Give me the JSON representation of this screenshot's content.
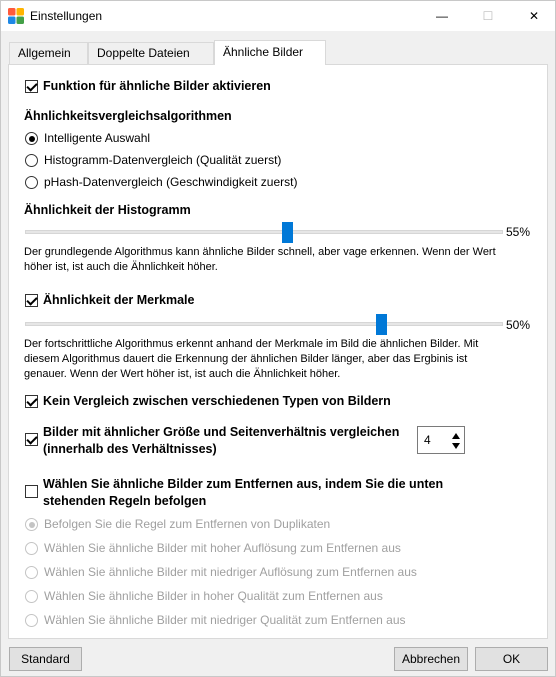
{
  "window": {
    "title": "Einstellungen",
    "min_glyph": "—",
    "max_glyph": "☐",
    "close_glyph": "✕",
    "icon": "app-logo-icon"
  },
  "tabs": [
    {
      "label": "Allgemein"
    },
    {
      "label": "Doppelte Dateien"
    },
    {
      "label": "Ähnliche Bilder",
      "active": true
    }
  ],
  "settings": {
    "enable_label": "Funktion für ähnliche Bilder aktivieren",
    "enable_checked": true,
    "algo_heading": "Ähnlichkeitsvergleichsalgorithmen",
    "algos": [
      {
        "label": "Intelligente Auswahl",
        "selected": true
      },
      {
        "label": "Histogramm-Datenvergleich (Qualität zuerst)",
        "selected": false
      },
      {
        "label": "pHash-Datenvergleich (Geschwindigkeit zuerst)",
        "selected": false
      }
    ],
    "histogram_heading": "Ähnlichkeit der Histogramm",
    "histogram_value": 0.55,
    "histogram_pct": "55%",
    "histogram_desc_1": "Der grundlegende Algorithmus kann ähnliche Bilder schnell, aber vage erkennen. Wenn der Wert",
    "histogram_desc_2": "höher ist, ist auch die Ähnlichkeit höher.",
    "features_label": "Ähnlichkeit der Merkmale",
    "features_checked": true,
    "features_value": 0.5,
    "features_pct": "50%",
    "features_desc_1": "Der fortschrittliche Algorithmus erkennt anhand der Merkmale im Bild die ähnlichen Bilder. Mit",
    "features_desc_2": "diesem Algorithmus  dauert die Erkennung der ähnlichen Bilder länger, aber das Ergbinis ist",
    "features_desc_3": "genauer. Wenn der Wert höher ist, ist auch die Ähnlichkeit höher.",
    "no_compare_label": "Kein Vergleich zwischen verschiedenen Typen von Bildern",
    "no_compare_checked": true,
    "size_label_1": "Bilder mit ähnlicher Größe und Seitenverhältnis vergleichen",
    "size_label_2": "(innerhalb des Verhältnisses)",
    "size_checked": true,
    "size_ratio": "4",
    "select_label_1": "Wählen Sie ähnliche Bilder zum Entfernen aus, indem Sie die unten",
    "select_label_2": "stehenden Regeln befolgen",
    "select_checked": false,
    "rules": [
      {
        "label": "Befolgen Sie die Regel zum Entfernen von Duplikaten",
        "selected": true
      },
      {
        "label": "Wählen Sie ähnliche Bilder mit hoher Auflösung zum Entfernen aus",
        "selected": false
      },
      {
        "label": "Wählen Sie ähnliche Bilder mit niedriger Auflösung zum Entfernen aus",
        "selected": false
      },
      {
        "label": "Wählen Sie ähnliche Bilder in hoher Qualität zum Entfernen aus",
        "selected": false
      },
      {
        "label": "Wählen Sie ähnliche Bilder mit niedriger Qualität zum Entfernen aus",
        "selected": false
      }
    ]
  },
  "footer": {
    "default_label": "Standard",
    "cancel_label": "Abbrechen",
    "ok_label": "OK"
  }
}
